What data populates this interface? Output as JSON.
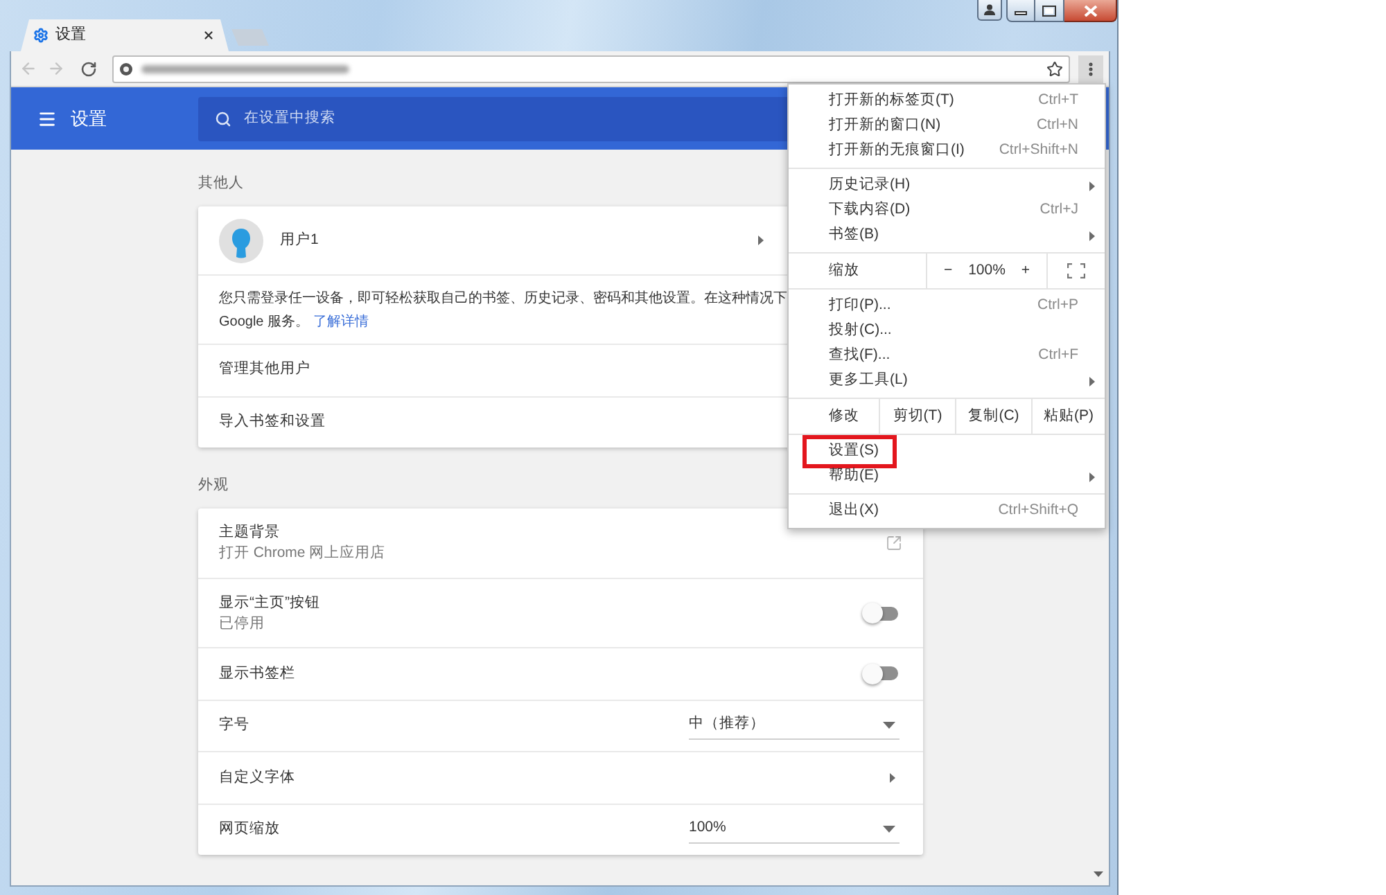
{
  "tabs": [
    {
      "title": "设置",
      "selected": true
    }
  ],
  "toolbar": {
    "back": {
      "disabled": true
    },
    "forward": {
      "disabled": true
    },
    "menu_button": {
      "pressed": true
    }
  },
  "header": {
    "title": "设置",
    "search": {
      "placeholder": "在设置中搜索"
    }
  },
  "sections": [
    {
      "title": "其他人",
      "rows": [
        {
          "kind": "profile",
          "label": "用户1"
        },
        {
          "kind": "paragraph",
          "lines": [
            "您只需登录任一设备，即可轻松获取自己的书签、历史记录、密码和其他设置。在这种情况下",
            "Google 服务。"
          ],
          "link": "了解详情"
        },
        {
          "kind": "plain",
          "label": "管理其他用户"
        },
        {
          "kind": "plain",
          "label": "导入书签和设置"
        }
      ]
    },
    {
      "title": "外观",
      "rows": [
        {
          "kind": "external",
          "label": "主题背景",
          "sublabel": "打开 Chrome 网上应用店"
        },
        {
          "kind": "toggle",
          "label": "显示“主页”按钮",
          "sublabel": "已停用",
          "on": false
        },
        {
          "kind": "toggle",
          "label": "显示书签栏",
          "on": false
        },
        {
          "kind": "select",
          "label": "字号",
          "value": "中（推荐）"
        },
        {
          "kind": "submenu",
          "label": "自定义字体"
        },
        {
          "kind": "select",
          "label": "网页缩放",
          "value": "100%"
        }
      ]
    }
  ],
  "menu": {
    "sections": [
      {
        "kind": "items",
        "items": [
          {
            "label": "打开新的标签页(T)",
            "shortcut": "Ctrl+T",
            "submenu": false,
            "highlighted": false
          },
          {
            "label": "打开新的窗口(N)",
            "shortcut": "Ctrl+N",
            "submenu": false,
            "highlighted": false
          },
          {
            "label": "打开新的无痕窗口(I)",
            "shortcut": "Ctrl+Shift+N",
            "submenu": false,
            "highlighted": false
          }
        ]
      },
      {
        "kind": "items",
        "items": [
          {
            "label": "历史记录(H)",
            "submenu": true,
            "highlighted": false
          },
          {
            "label": "下载内容(D)",
            "shortcut": "Ctrl+J",
            "submenu": false,
            "highlighted": false
          },
          {
            "label": "书签(B)",
            "submenu": true,
            "highlighted": false
          }
        ]
      },
      {
        "kind": "zoom",
        "label": "缩放",
        "minus": "−",
        "value": "100%",
        "plus": "+"
      },
      {
        "kind": "items",
        "items": [
          {
            "label": "打印(P)...",
            "shortcut": "Ctrl+P",
            "submenu": false,
            "highlighted": false
          },
          {
            "label": "投射(C)...",
            "submenu": false,
            "highlighted": false
          },
          {
            "label": "查找(F)...",
            "shortcut": "Ctrl+F",
            "submenu": false,
            "highlighted": false
          },
          {
            "label": "更多工具(L)",
            "submenu": true,
            "highlighted": false
          }
        ]
      },
      {
        "kind": "edit",
        "label": "修改",
        "actions": [
          "剪切(T)",
          "复制(C)",
          "粘贴(P)"
        ]
      },
      {
        "kind": "items",
        "items": [
          {
            "label": "设置(S)",
            "submenu": false,
            "highlighted": true
          },
          {
            "label": "帮助(E)",
            "submenu": true,
            "highlighted": false
          }
        ]
      },
      {
        "kind": "items",
        "items": [
          {
            "label": "退出(X)",
            "shortcut": "Ctrl+Shift+Q",
            "submenu": false,
            "highlighted": false
          }
        ]
      }
    ]
  }
}
